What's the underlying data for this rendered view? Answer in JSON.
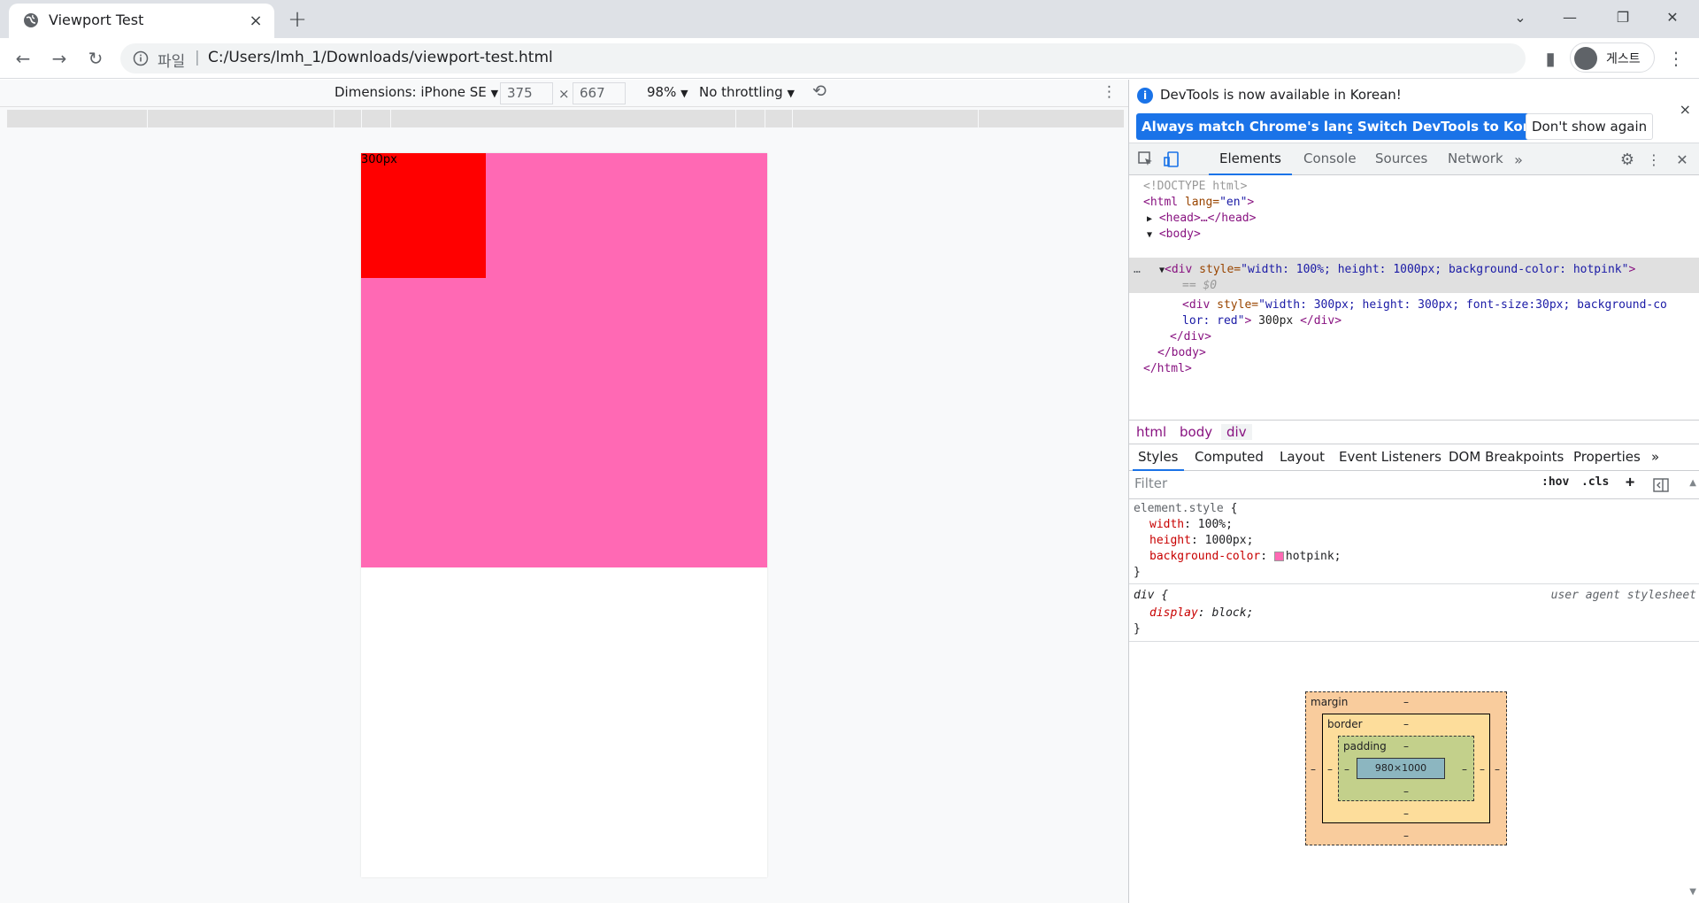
{
  "browser": {
    "tab_title": "Viewport Test",
    "tab_close": "×",
    "new_tab": "+",
    "window_controls": [
      "⌄",
      "—",
      "❐",
      "✕"
    ],
    "omnibox_scheme": "파일",
    "omnibox_sep": "|",
    "omnibox_url": "C:/Users/lmh_1/Downloads/viewport-test.html",
    "profile_label": "게스트",
    "nav": {
      "back": "←",
      "forward": "→",
      "reload": "↻",
      "side_panel": "▮",
      "menu": "⋮"
    }
  },
  "device_toolbar": {
    "dimensions_label": "Dimensions: iPhone SE",
    "width": "375",
    "times": "×",
    "height": "667",
    "zoom": "98%",
    "throttling": "No throttling",
    "dropdown_glyph": "▼",
    "rotate_icon": "⟲",
    "more": "⋮"
  },
  "page": {
    "red_box_text": "300px",
    "colors": {
      "pink": "#ff69b4",
      "red": "#ff0000"
    }
  },
  "devtools": {
    "info_message": "DevTools is now available in Korean!",
    "btn_match": "Always match Chrome's language",
    "btn_switch": "Switch DevTools to Korean",
    "btn_dont_show": "Don't show again",
    "close": "×",
    "tabs": [
      "Elements",
      "Console",
      "Sources",
      "Network"
    ],
    "more_tabs": "»",
    "dom": {
      "doctype": "<!DOCTYPE html>",
      "html_open_tag": "<html",
      "html_attr": " lang=",
      "html_attr_val": "\"en\"",
      "html_close_bracket": ">",
      "head_collapsed": "<head>…</head>",
      "body_open": "<body>",
      "div_open_tag": "<div",
      "div_attr": " style=",
      "div_attr_val": "\"width: 100%; height: 1000px; background-color: hotpink\"",
      "div_close_bracket": ">",
      "dollar_zero": "== $0",
      "inner_div_tag": "<div",
      "inner_div_attr": " style=",
      "inner_div_val_line1": "\"width: 300px; height: 300px; font-size:30px; background-co",
      "inner_div_val_line2": "lor: red\"",
      "inner_close_bracket": ">",
      "inner_text": " 300px ",
      "inner_div_close": "</div>",
      "div_close": "</div>",
      "body_close": "</body>",
      "html_close": "</html>",
      "ellipsis": "…"
    },
    "breadcrumbs": [
      "html",
      "body",
      "div"
    ],
    "sub_tabs": [
      "Styles",
      "Computed",
      "Layout",
      "Event Listeners",
      "DOM Breakpoints",
      "Properties"
    ],
    "sub_more": "»",
    "filter_placeholder": "Filter",
    "hov": ":hov",
    "cls": ".cls",
    "plus": "+",
    "rules": {
      "element_selector": "element.style",
      "open_brace": " {",
      "close_brace": "}",
      "props": [
        {
          "name": "width",
          "value": "100%;"
        },
        {
          "name": "height",
          "value": "1000px;"
        },
        {
          "name": "background-color",
          "value": "hotpink;"
        }
      ],
      "div_selector": "div",
      "ua_label": "user agent stylesheet",
      "div_prop": "display",
      "div_val": "block;"
    },
    "box_model": {
      "margin_label": "margin",
      "border_label": "border",
      "padding_label": "padding",
      "content": "980×1000",
      "dash": "–"
    }
  }
}
